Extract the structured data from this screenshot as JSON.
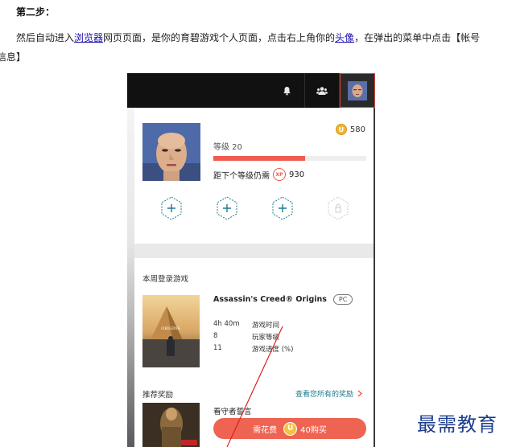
{
  "doc": {
    "step_title": "第二步：",
    "line1_before": "然后自动进入",
    "line1_link1": "浏览器",
    "line1_mid": "网页页面，是你的育碧游戏个人页面，点击右上角你的",
    "line1_link2": "头像",
    "line1_after": "，在弹出的菜单中点击【帐号",
    "line2": "信息】"
  },
  "topbar": {
    "icons": [
      "bell-icon",
      "friends-icon",
      "avatar"
    ]
  },
  "profile": {
    "coins": "580",
    "coin_symbol": "U",
    "level_text": "等级 20",
    "xp_progress": 0.6,
    "xp_label": "距下个等级仍需",
    "xp_badge": "XP",
    "xp_remaining": "930",
    "slots": [
      "add-slot-icon",
      "add-slot-icon",
      "add-slot-icon",
      "locked-slot-icon"
    ]
  },
  "weekly": {
    "section_title": "本周登录游戏",
    "game_title": "Assassin's Creed® Origins",
    "platform": "PC",
    "stats": [
      {
        "value": "4h 40m",
        "label": "游戏时间"
      },
      {
        "value": "8",
        "label": "玩家等级"
      },
      {
        "value": "11",
        "label": "游戏进度 (%)"
      }
    ]
  },
  "rewards": {
    "section_title": "推荐奖励",
    "link_text": "查看您所有的奖励",
    "reward_title": "看守者誓言",
    "buy_label": "需花费",
    "buy_coin": "U",
    "buy_price": "40购买"
  },
  "watermark": "最需教育",
  "colors": {
    "accent": "#ef5b4e",
    "link": "#1a0dab",
    "teal": "#1e7a8c",
    "topbar": "#111111",
    "coin": "#f2b533",
    "watermark": "#1d3e8c"
  }
}
